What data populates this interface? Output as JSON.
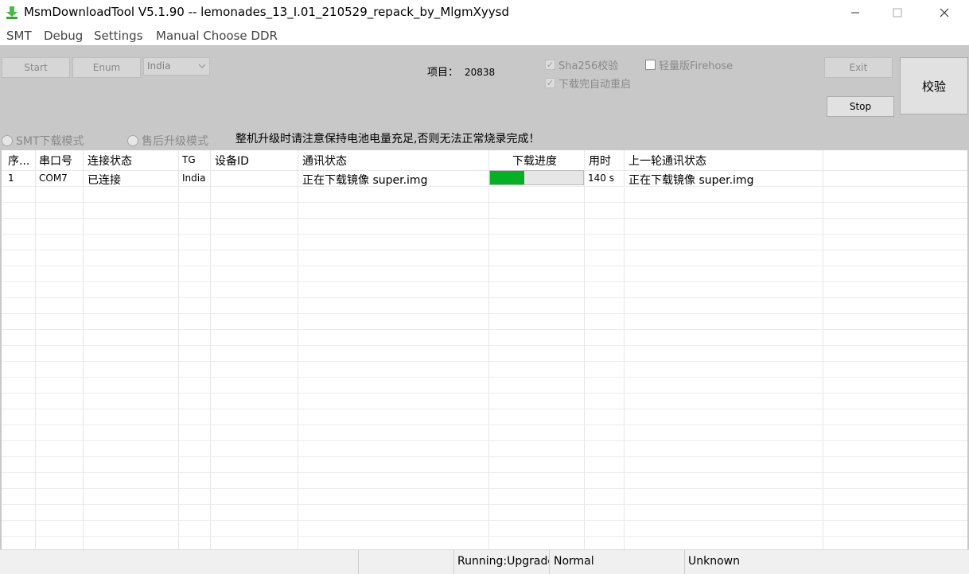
{
  "window": {
    "title": "MsmDownloadTool V5.1.90 -- lemonades_13_I.01_210529_repack_by_MlgmXyysd",
    "icon": "download-arrow-icon",
    "accent_color": "#06b025"
  },
  "menu": {
    "items": [
      "SMT",
      "Debug",
      "Settings",
      "Manual Choose DDR"
    ]
  },
  "toolbar": {
    "start_label": "Start",
    "enum_label": "Enum",
    "region_value": "India",
    "project_label": "项目：",
    "project_value": "20838",
    "sha256_label": "Sha256校验",
    "lite_firehose_label": "轻量版Firehose",
    "auto_reboot_label": "下载完自动重启",
    "exit_label": "Exit",
    "stop_label": "Stop",
    "verify_label": "校验",
    "mode_smt_label": "SMT下载模式",
    "mode_aftersale_label": "售后升级模式",
    "warning_text": "整机升级时请注意保持电池电量充足,否则无法正常烧录完成！"
  },
  "table": {
    "headers": [
      "序...",
      "串口号",
      "连接状态",
      "TG",
      "设备ID",
      "通讯状态",
      "下载进度",
      "用时",
      "上一轮通讯状态"
    ],
    "rows": [
      {
        "index": "1",
        "port": "COM7",
        "connection": "已连接",
        "tg": "India",
        "device_id": "",
        "comm_status": "正在下载镜像 super.img",
        "progress": 0.37,
        "time": "140 s",
        "last_status": "正在下载镜像 super.img"
      }
    ]
  },
  "status_bar": {
    "running": "Running:Upgrade",
    "mode": "Normal",
    "state": "Unknown"
  }
}
